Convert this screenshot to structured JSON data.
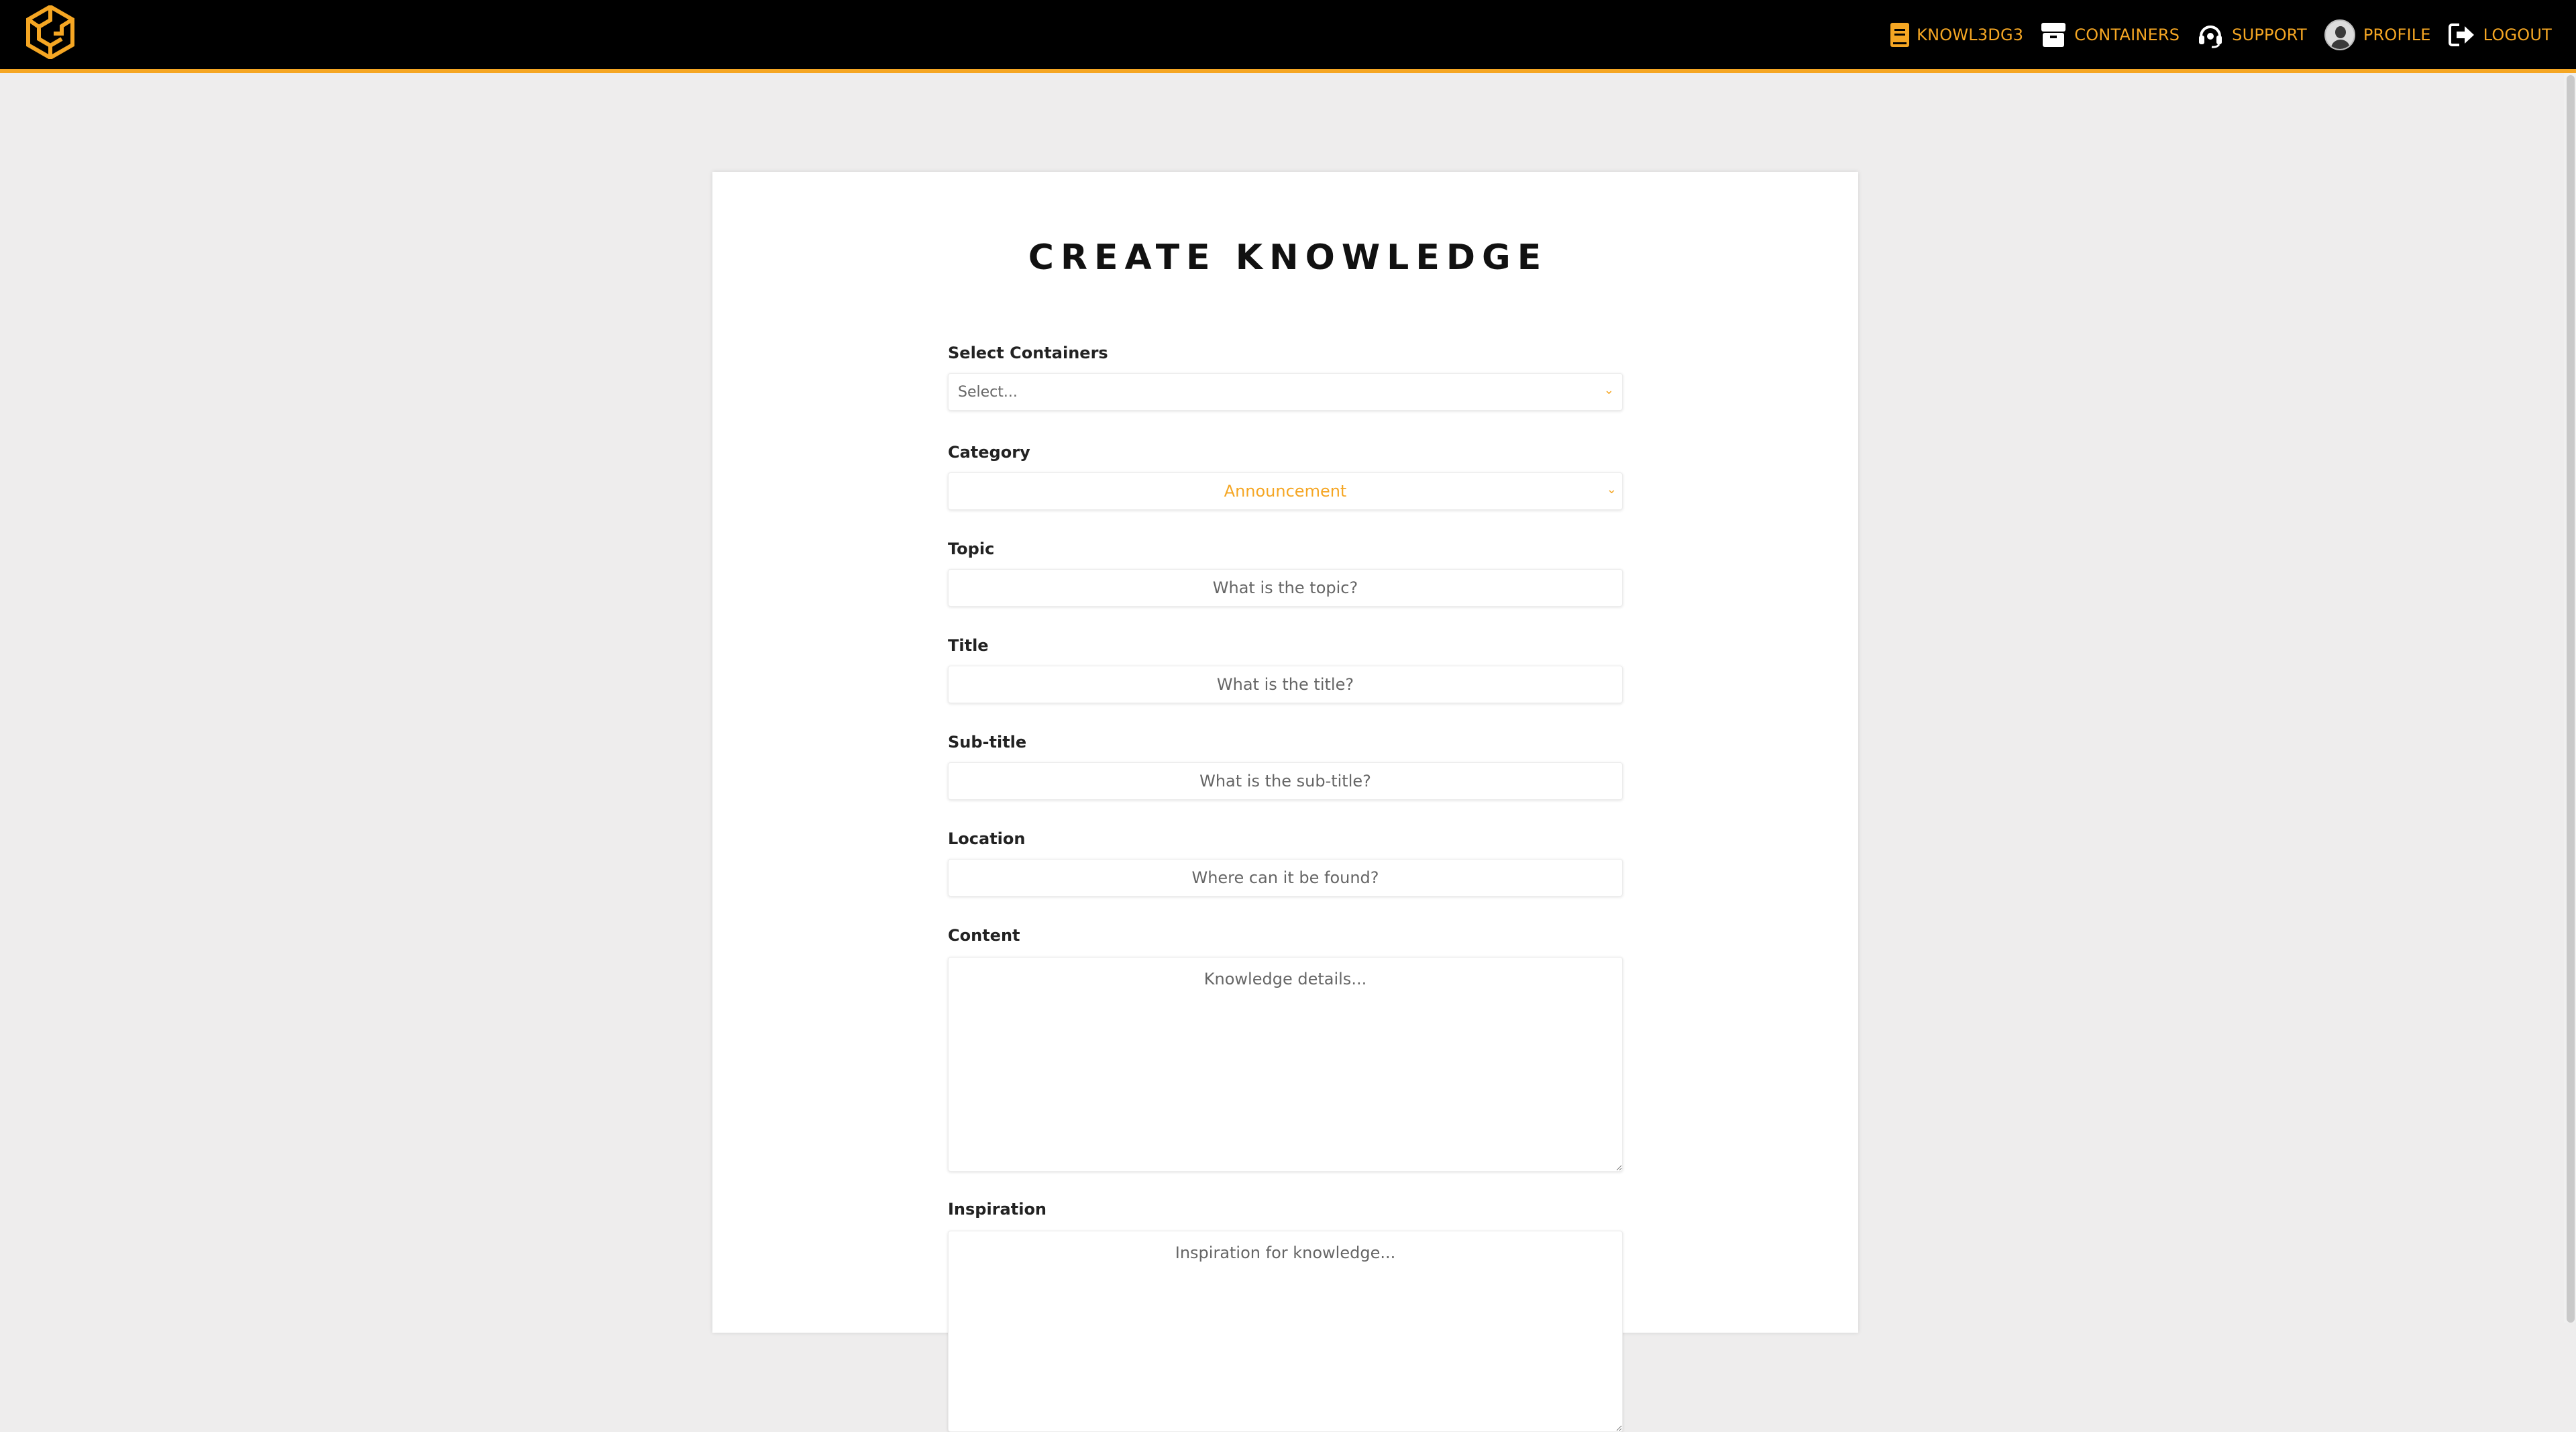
{
  "nav": {
    "items": [
      {
        "label": "KNOWL3DG3",
        "icon": "book-icon"
      },
      {
        "label": "CONTAINERS",
        "icon": "box-icon"
      },
      {
        "label": "SUPPORT",
        "icon": "headset-icon"
      },
      {
        "label": "PROFILE",
        "icon": "avatar"
      },
      {
        "label": "LOGOUT",
        "icon": "logout-icon"
      }
    ]
  },
  "colors": {
    "accent": "#f5a623",
    "topbar": "#000000",
    "page_bg": "#eeeded"
  },
  "page": {
    "title": "CREATE KNOWLEDGE"
  },
  "form": {
    "containers": {
      "label": "Select Containers",
      "placeholder": "Select..."
    },
    "category": {
      "label": "Category",
      "value": "Announcement"
    },
    "topic": {
      "label": "Topic",
      "placeholder": "What is the topic?"
    },
    "title": {
      "label": "Title",
      "placeholder": "What is the title?"
    },
    "subtitle": {
      "label": "Sub-title",
      "placeholder": "What is the sub-title?"
    },
    "location": {
      "label": "Location",
      "placeholder": "Where can it be found?"
    },
    "content": {
      "label": "Content",
      "placeholder": "Knowledge details..."
    },
    "inspiration": {
      "label": "Inspiration",
      "placeholder": "Inspiration for knowledge..."
    }
  }
}
